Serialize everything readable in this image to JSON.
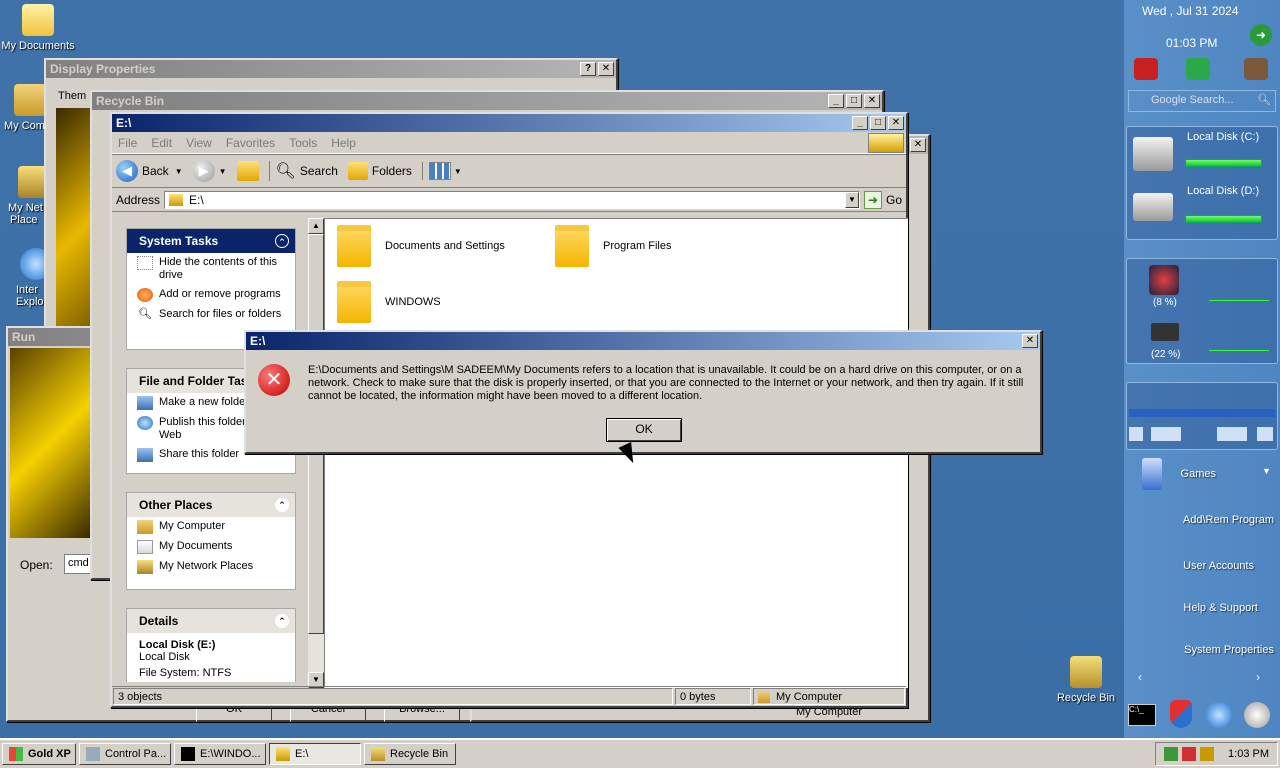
{
  "desktop": {
    "icons": [
      "My Documents",
      "My Comp",
      "My Net",
      "Place",
      "Inter",
      "Explo",
      "Recycle Bin"
    ]
  },
  "display_properties": {
    "title": "Display Properties",
    "tab": "Them",
    "help": "?",
    "close": "✕"
  },
  "run_dialog": {
    "title": "Run",
    "open_label": "Open:",
    "open_value": "cmd",
    "buttons": [
      "OK",
      "Cancel",
      "Browse..."
    ]
  },
  "recycle_bin_window": {
    "title": "Recycle Bin"
  },
  "explorer": {
    "title": "E:\\",
    "menu": [
      "File",
      "Edit",
      "View",
      "Favorites",
      "Tools",
      "Help"
    ],
    "toolbar": {
      "back": "Back",
      "search": "Search",
      "folders": "Folders"
    },
    "address_label": "Address",
    "address_value": "E:\\",
    "go": "Go",
    "system_tasks": {
      "title": "System Tasks",
      "items": [
        "Hide the contents of this drive",
        "Add or remove programs",
        "Search for files or folders"
      ]
    },
    "file_folder_tasks": {
      "title": "File and Folder Tasks",
      "items": [
        "Make a new folder",
        "Publish this folder to the Web",
        "Share this folder"
      ]
    },
    "other_places": {
      "title": "Other Places",
      "items": [
        "My Computer",
        "My Documents",
        "My Network Places"
      ]
    },
    "details": {
      "title": "Details",
      "name": "Local Disk (E:)",
      "type": "Local Disk",
      "fs": "File System: NTFS"
    },
    "folders": [
      "Documents and Settings",
      "Program Files",
      "WINDOWS"
    ],
    "status": {
      "objects": "3 objects",
      "size": "0 bytes",
      "location": "My Computer"
    }
  },
  "error_dialog": {
    "title": "E:\\",
    "message": "E:\\Documents and Settings\\M SADEEM\\My Documents refers to a location that is unavailable. It could be on a hard drive on this computer, or on a network. Check to make sure that the disk is properly inserted, or that you are connected to the Internet or your network, and then try again. If it still cannot be located, the information might have been moved to a different location.",
    "ok": "OK"
  },
  "sidebar": {
    "date": "Wed , Jul 31 2024",
    "time": "01:03 PM",
    "search_placeholder": "Google Search...",
    "disk_c": "Local Disk (C:)",
    "disk_c_fill": 0.9,
    "disk_d": "Local Disk (D:)",
    "disk_d_fill": 0.9,
    "cpu": "(8 %)",
    "mem": "(22 %)",
    "links": [
      "Games",
      "Add\\Rem Program",
      "User Accounts",
      "Help & Support",
      "System Properties"
    ]
  },
  "taskbar": {
    "start": "Gold XP",
    "tasks": [
      "Control Pa...",
      "E:\\WINDO...",
      "E:\\",
      "Recycle Bin"
    ],
    "clock": "1:03 PM"
  },
  "colors": {
    "desktop": "#3a6ea5",
    "active_title": "#0a246a",
    "error_red": "#c00000",
    "folder_yellow": "#f5b400"
  }
}
